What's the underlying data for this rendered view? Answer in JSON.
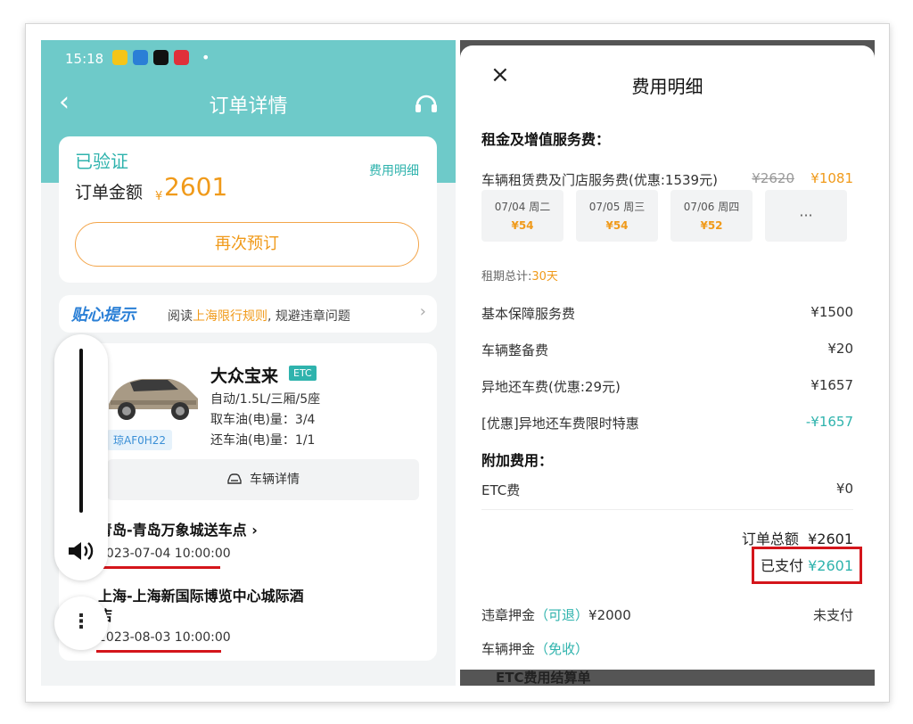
{
  "left": {
    "status_bar": {
      "time": "15:18",
      "dot": "•"
    },
    "nav": {
      "back": "‹",
      "title": "订单详情"
    },
    "order_card": {
      "status": "已验证",
      "fee_detail_link": "费用明细",
      "amount_label": "订单金额",
      "currency": "¥",
      "amount": "2601",
      "rebook_button": "再次预订"
    },
    "tip": {
      "title": "贴心提示",
      "text_prefix": "阅读",
      "text_highlight": "上海限行规则",
      "text_suffix": ", 规避违章问题"
    },
    "car": {
      "name": "大众宝来",
      "etc": "ETC",
      "spec": "自动/1.5L/三厢/5座",
      "pickup_fuel": "取车油(电)量：3/4",
      "return_fuel": "还车油(电)量：1/1",
      "plate": "琼AF0H22",
      "detail_button": "车辆详情"
    },
    "pickup": {
      "location": "青岛-青岛万象城送车点",
      "time": "2023-07-04 10:00:00",
      "arrow": "›"
    },
    "return": {
      "location_line1": "上海-上海新国际博览中心城际酒",
      "location_line2": "店",
      "time": "2023-08-03 10:00:00"
    },
    "volume": {
      "level": 1.0
    }
  },
  "right": {
    "close": "×",
    "title": "费用明细",
    "section_rent": "租金及增值服务费：",
    "rent_row": {
      "label": "车辆租赁费及门店服务费(优惠:1539元)",
      "original": "¥2620",
      "value": "¥1081"
    },
    "days": [
      {
        "date": "07/04 周二",
        "price": "¥54"
      },
      {
        "date": "07/05 周三",
        "price": "¥54"
      },
      {
        "date": "07/06 周四",
        "price": "¥52"
      }
    ],
    "more_days": "···",
    "rent_period_label": "租期总计:",
    "rent_period_value": "30天",
    "rows": [
      {
        "label": "基本保障服务费",
        "value": "¥1500",
        "color": "#333333"
      },
      {
        "label": "车辆整备费",
        "value": "¥20",
        "color": "#333333"
      },
      {
        "label": "异地还车费(优惠:29元)",
        "value": "¥1657",
        "color": "#333333"
      },
      {
        "label": "[优惠]异地还车费限时特惠",
        "value": "-¥1657",
        "color": "#2fb3ad"
      }
    ],
    "section_extra": "附加费用：",
    "etc_row": {
      "label": "ETC费",
      "value": "¥0"
    },
    "total": {
      "label": "订单总额",
      "value": "¥2601"
    },
    "paid": {
      "label": "已支付",
      "value": "¥2601"
    },
    "deposit": {
      "label": "违章押金",
      "tag": "（可退）",
      "value": "¥2000",
      "status": "未支付"
    },
    "vehicle_deposit": {
      "label": "车辆押金",
      "tag": "（免收）"
    },
    "bottom": "ETC费用结算单"
  }
}
